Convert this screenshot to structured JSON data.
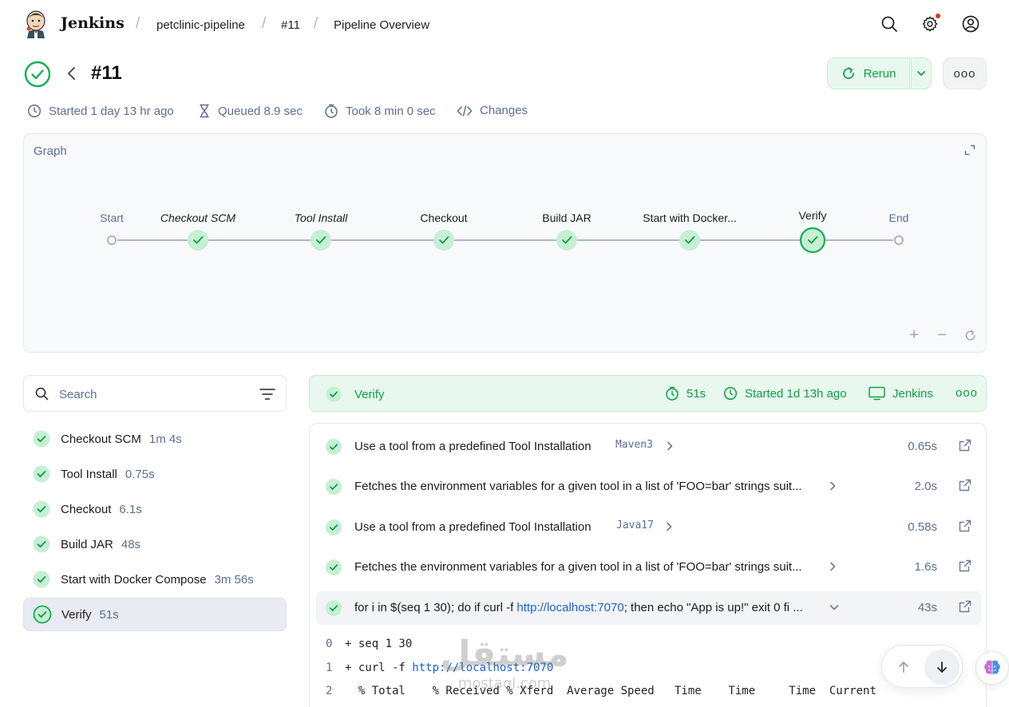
{
  "brand": {
    "name": "Jenkins",
    "icon": "jenkins-butler-logo"
  },
  "breadcrumbs": [
    {
      "label": "petclinic-pipeline"
    },
    {
      "label": "#11"
    },
    {
      "label": "Pipeline Overview"
    }
  ],
  "header_icons": [
    "search-icon",
    "gear-icon",
    "user-icon"
  ],
  "run": {
    "title": "#11",
    "status": "success",
    "rerun_label": "Rerun",
    "more_label": "ooo"
  },
  "meta": {
    "started": "Started 1 day 13 hr ago",
    "queued": "Queued 8.9 sec",
    "took": "Took 8 min 0 sec",
    "changes": "Changes"
  },
  "graph": {
    "title": "Graph",
    "nodes": [
      {
        "label": "Start",
        "kind": "terminal"
      },
      {
        "label": "Checkout SCM",
        "kind": "stage",
        "italic": true
      },
      {
        "label": "Tool Install",
        "kind": "stage",
        "italic": true
      },
      {
        "label": "Checkout",
        "kind": "stage"
      },
      {
        "label": "Build JAR",
        "kind": "stage"
      },
      {
        "label": "Start with Docker...",
        "kind": "stage"
      },
      {
        "label": "Verify",
        "kind": "stage",
        "selected": true
      },
      {
        "label": "End",
        "kind": "terminal"
      }
    ],
    "controls": {
      "zoom_in": "+",
      "zoom_out": "−"
    }
  },
  "sidebar": {
    "search_placeholder": "Search",
    "stages": [
      {
        "name": "Checkout SCM",
        "duration": "1m 4s"
      },
      {
        "name": "Tool Install",
        "duration": "0.75s"
      },
      {
        "name": "Checkout",
        "duration": "6.1s"
      },
      {
        "name": "Build JAR",
        "duration": "48s"
      },
      {
        "name": "Start with Docker Compose",
        "duration": "3m 56s"
      },
      {
        "name": "Verify",
        "duration": "51s",
        "active": true
      }
    ]
  },
  "stage_detail": {
    "name": "Verify",
    "duration": "51s",
    "started": "Started 1d 13h ago",
    "agent": "Jenkins",
    "more_label": "ooo",
    "steps": [
      {
        "text": "Use a tool from a predefined Tool Installation",
        "tag": "Maven3",
        "duration": "0.65s"
      },
      {
        "text": "Fetches the environment variables for a given tool in a list of 'FOO=bar' strings suit...",
        "tag": "",
        "duration": "2.0s"
      },
      {
        "text": "Use a tool from a predefined Tool Installation",
        "tag": "Java17",
        "duration": "0.58s"
      },
      {
        "text": "Fetches the environment variables for a given tool in a list of 'FOO=bar' strings suit...",
        "tag": "",
        "duration": "1.6s"
      },
      {
        "text_before": "for i in $(seq 1 30); do if curl -f ",
        "link": "http://localhost:7070",
        "text_after": "; then echo \"App is up!\" exit 0 fi ...",
        "duration": "43s",
        "expanded": true
      }
    ],
    "log": [
      {
        "num": "0",
        "text": "+ seq 1 30"
      },
      {
        "num": "1",
        "text_before": "+ curl -f ",
        "link": "http://localhost:7070"
      },
      {
        "num": "2",
        "text": "  % Total    % Received % Xferd  Average Speed   Time    Time     Time  Current"
      }
    ]
  },
  "watermark": {
    "text": "مستقل",
    "subtext": "mostaql.com"
  },
  "colors": {
    "success": "#0e9f45",
    "success_bg": "#e8f8ee",
    "muted": "#5c6f8f",
    "link": "#1a62d6"
  }
}
